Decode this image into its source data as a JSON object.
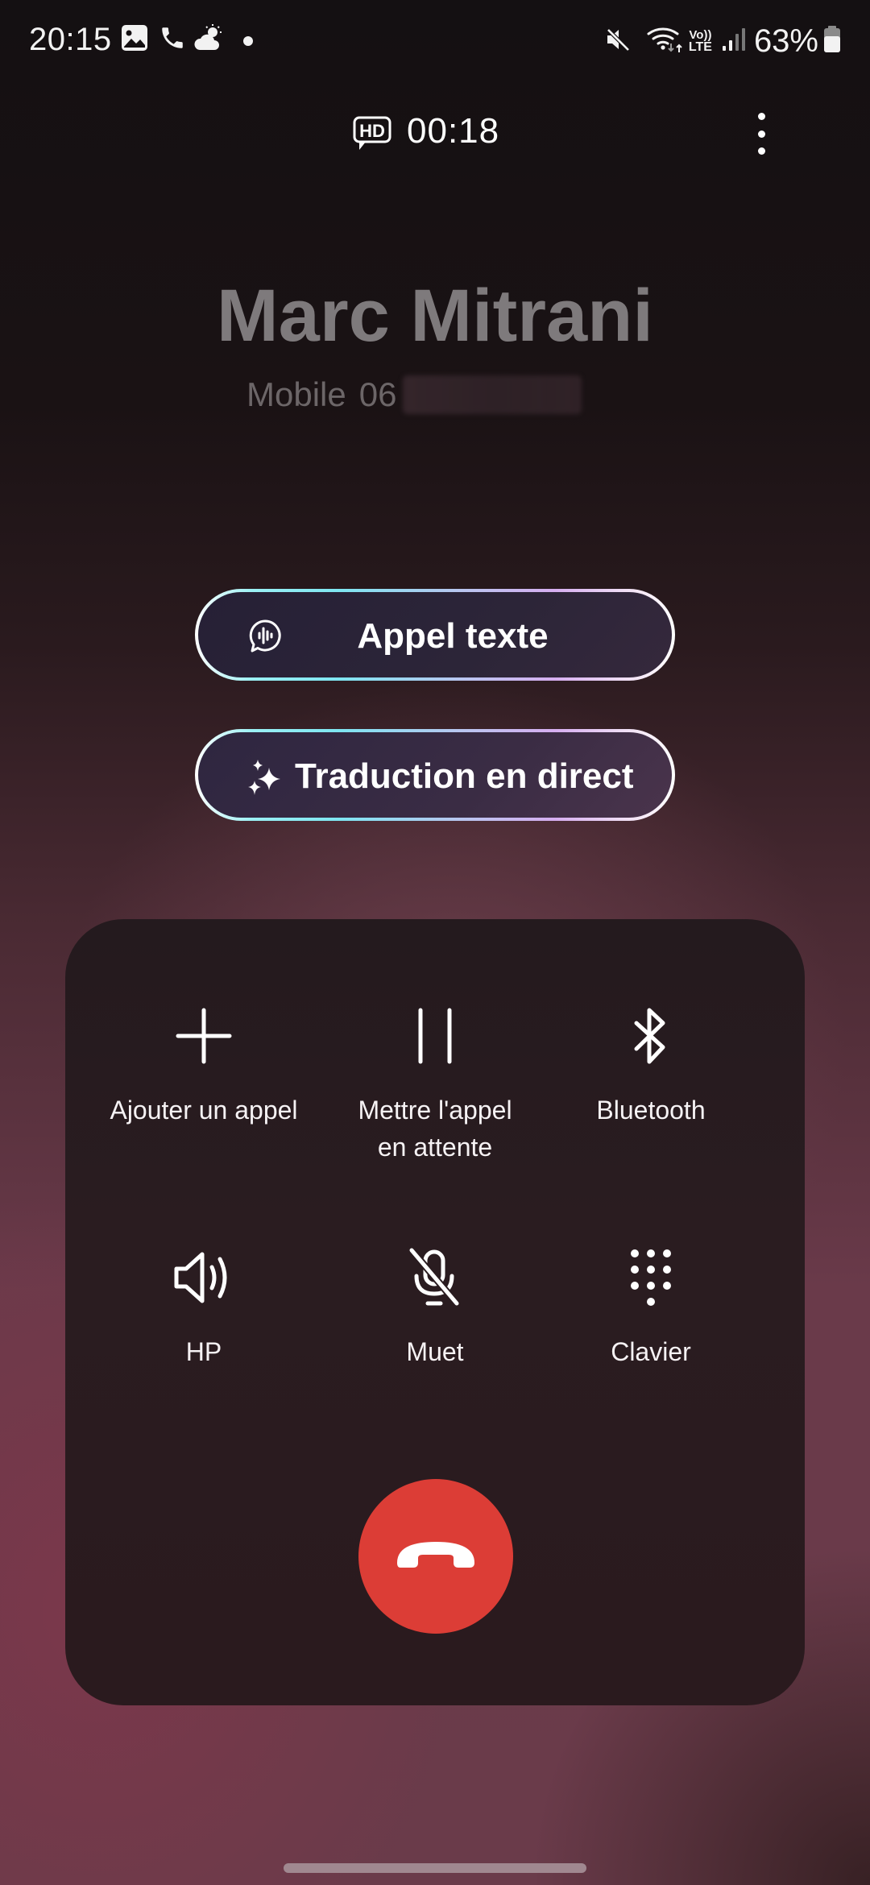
{
  "status_bar": {
    "time": "20:15",
    "left_icons": [
      "gallery-icon",
      "phone-icon",
      "weather-partly-cloudy-icon",
      "notification-dot-icon"
    ],
    "right_icons": [
      "mute-icon",
      "wifi-icon",
      "volte-icon",
      "signal-icon",
      "battery-icon"
    ],
    "volte_top": "Vo))",
    "volte_bottom": "LTE",
    "battery_percent": "63%"
  },
  "call": {
    "hd_badge": "HD",
    "duration": "00:18",
    "more_options_icon": "more-vertical-icon"
  },
  "contact": {
    "name": "Marc Mitrani",
    "type": "Mobile",
    "number_visible": "06"
  },
  "actions": {
    "text_call_label": "Appel texte",
    "text_call_icon": "voice-chat-icon",
    "live_translate_label": "Traduction en direct",
    "live_translate_icon": "sparkle-icon"
  },
  "controls": [
    {
      "id": "add-call",
      "label": "Ajouter un appel",
      "icon": "plus-icon"
    },
    {
      "id": "hold",
      "label": "Mettre l'appel en attente",
      "icon": "pause-icon"
    },
    {
      "id": "bluetooth",
      "label": "Bluetooth",
      "icon": "bluetooth-icon"
    },
    {
      "id": "speaker",
      "label": "HP",
      "icon": "speaker-icon"
    },
    {
      "id": "mute",
      "label": "Muet",
      "icon": "mic-off-icon"
    },
    {
      "id": "keypad",
      "label": "Clavier",
      "icon": "keypad-icon"
    }
  ],
  "end_call": {
    "icon": "end-call-icon",
    "color": "#dc3d36"
  },
  "colors": {
    "end_call": "#dc3d36",
    "contact_name": "#7e7a7c",
    "pill_border_start": "#7ee6f2",
    "pill_border_end": "#d6aef0"
  }
}
